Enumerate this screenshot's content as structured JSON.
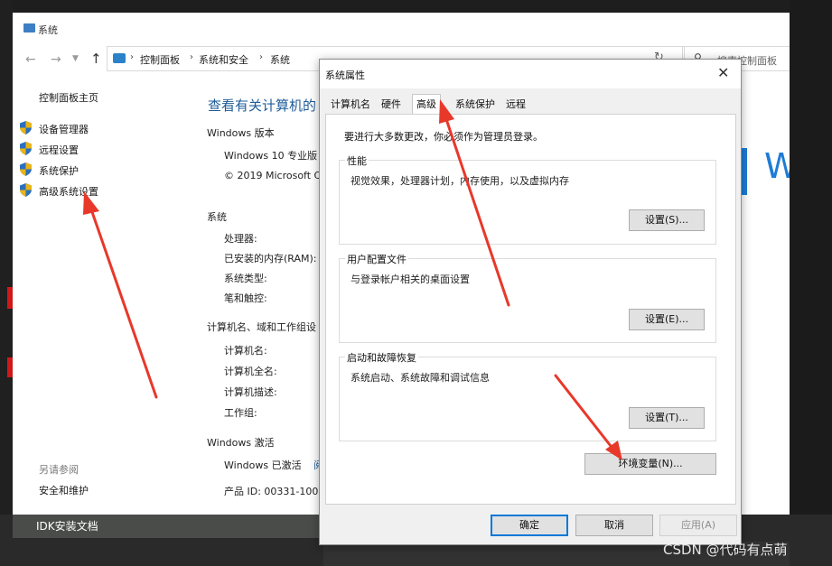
{
  "window": {
    "title": "系统",
    "back_icon": "back-arrow-icon",
    "forward_icon": "forward-arrow-icon",
    "up_icon": "up-arrow-icon"
  },
  "address": {
    "crumbs": [
      "控制面板",
      "系统和安全",
      "系统"
    ],
    "search_placeholder": "搜索控制面板"
  },
  "nav": {
    "home": "控制面板主页",
    "items": [
      {
        "label": "设备管理器",
        "icon": "shield-icon"
      },
      {
        "label": "远程设置",
        "icon": "shield-icon"
      },
      {
        "label": "系统保护",
        "icon": "shield-icon"
      },
      {
        "label": "高级系统设置",
        "icon": "shield-icon"
      }
    ],
    "see_also": "另请参阅",
    "security_maintenance": "安全和维护"
  },
  "main": {
    "heading": "查看有关计算机的",
    "edition_title": "Windows 版本",
    "edition_name": "Windows 10 专业版",
    "copyright": "© 2019 Microsoft C",
    "system_title": "系统",
    "processor": "处理器:",
    "ram": "已安装的内存(RAM):",
    "system_type": "系统类型:",
    "pen_touch": "笔和触控:",
    "computer_title": "计算机名、域和工作组设",
    "computer_name": "计算机名:",
    "full_name": "计算机全名:",
    "description": "计算机描述:",
    "workgroup": "工作组:",
    "activation_title": "Windows 激活",
    "activation_status": "Windows 已激活",
    "activation_link": "阅",
    "product_id": "产品 ID: 00331-100",
    "logo_letter": "W"
  },
  "dialog": {
    "title": "系统属性",
    "tabs": [
      "计算机名",
      "硬件",
      "高级",
      "系统保护",
      "远程"
    ],
    "active_tab": "高级",
    "admin_note": "要进行大多数更改，你必须作为管理员登录。",
    "performance": {
      "title": "性能",
      "desc": "视觉效果，处理器计划，内存使用，以及虚拟内存",
      "button": "设置(S)..."
    },
    "profiles": {
      "title": "用户配置文件",
      "desc": "与登录帐户相关的桌面设置",
      "button": "设置(E)..."
    },
    "startup": {
      "title": "启动和故障恢复",
      "desc": "系统启动、系统故障和调试信息",
      "button": "设置(T)..."
    },
    "env_button": "环境变量(N)...",
    "ok": "确定",
    "cancel": "取消",
    "apply": "应用(A)"
  },
  "background": {
    "taskbar_text": "IDK安装文档"
  },
  "watermark": "CSDN @代码有点萌",
  "colors": {
    "heading_blue": "#1f5c99",
    "arrow_red": "#e8382a",
    "focus_blue": "#0078d7"
  }
}
